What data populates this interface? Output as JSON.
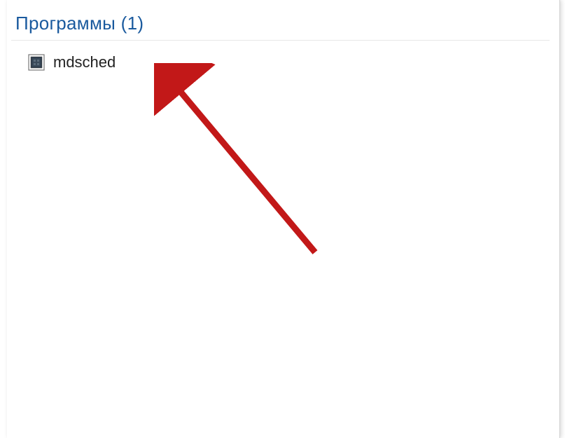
{
  "section": {
    "title": "Программы (1)"
  },
  "results": {
    "items": [
      {
        "label": "mdsched",
        "icon": "memory-diagnostic-icon"
      }
    ]
  }
}
